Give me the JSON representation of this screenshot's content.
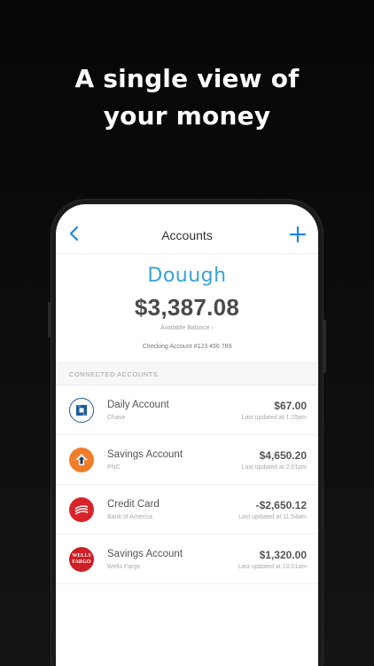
{
  "headline": {
    "line1": "A single view of",
    "line2": "your money"
  },
  "nav": {
    "title": "Accounts",
    "back_icon": "chevron-left-icon",
    "add_icon": "plus-icon"
  },
  "summary": {
    "brand": "Douugh",
    "balance": "$3,387.08",
    "balance_label": "Available Balance ›",
    "checking": "Checking Account #123 456 789"
  },
  "section": {
    "title": "CONNECTED ACCOUNTS"
  },
  "accounts": [
    {
      "name": "Daily Account",
      "bank": "Chase",
      "amount": "$67.00",
      "updated": "Last updated at 1:25pm"
    },
    {
      "name": "Savings Account",
      "bank": "PNC",
      "amount": "$4,650.20",
      "updated": "Last updated at 2:01pm"
    },
    {
      "name": "Credit Card",
      "bank": "Bank of America",
      "amount": "-$2,650.12",
      "updated": "Last updated at 11:54am"
    },
    {
      "name": "Savings Account",
      "bank": "Wells Fargo",
      "amount": "$1,320.00",
      "updated": "Last updated at 10:01am",
      "logo_text_1": "WELLS",
      "logo_text_2": "FARGO"
    }
  ],
  "colors": {
    "accent": "#1e88e5",
    "brand": "#3aa3d6",
    "chase": "#1d5a97",
    "pnc": "#ef7d2a",
    "boa": "#d8232a",
    "wells": "#cc1f26"
  }
}
